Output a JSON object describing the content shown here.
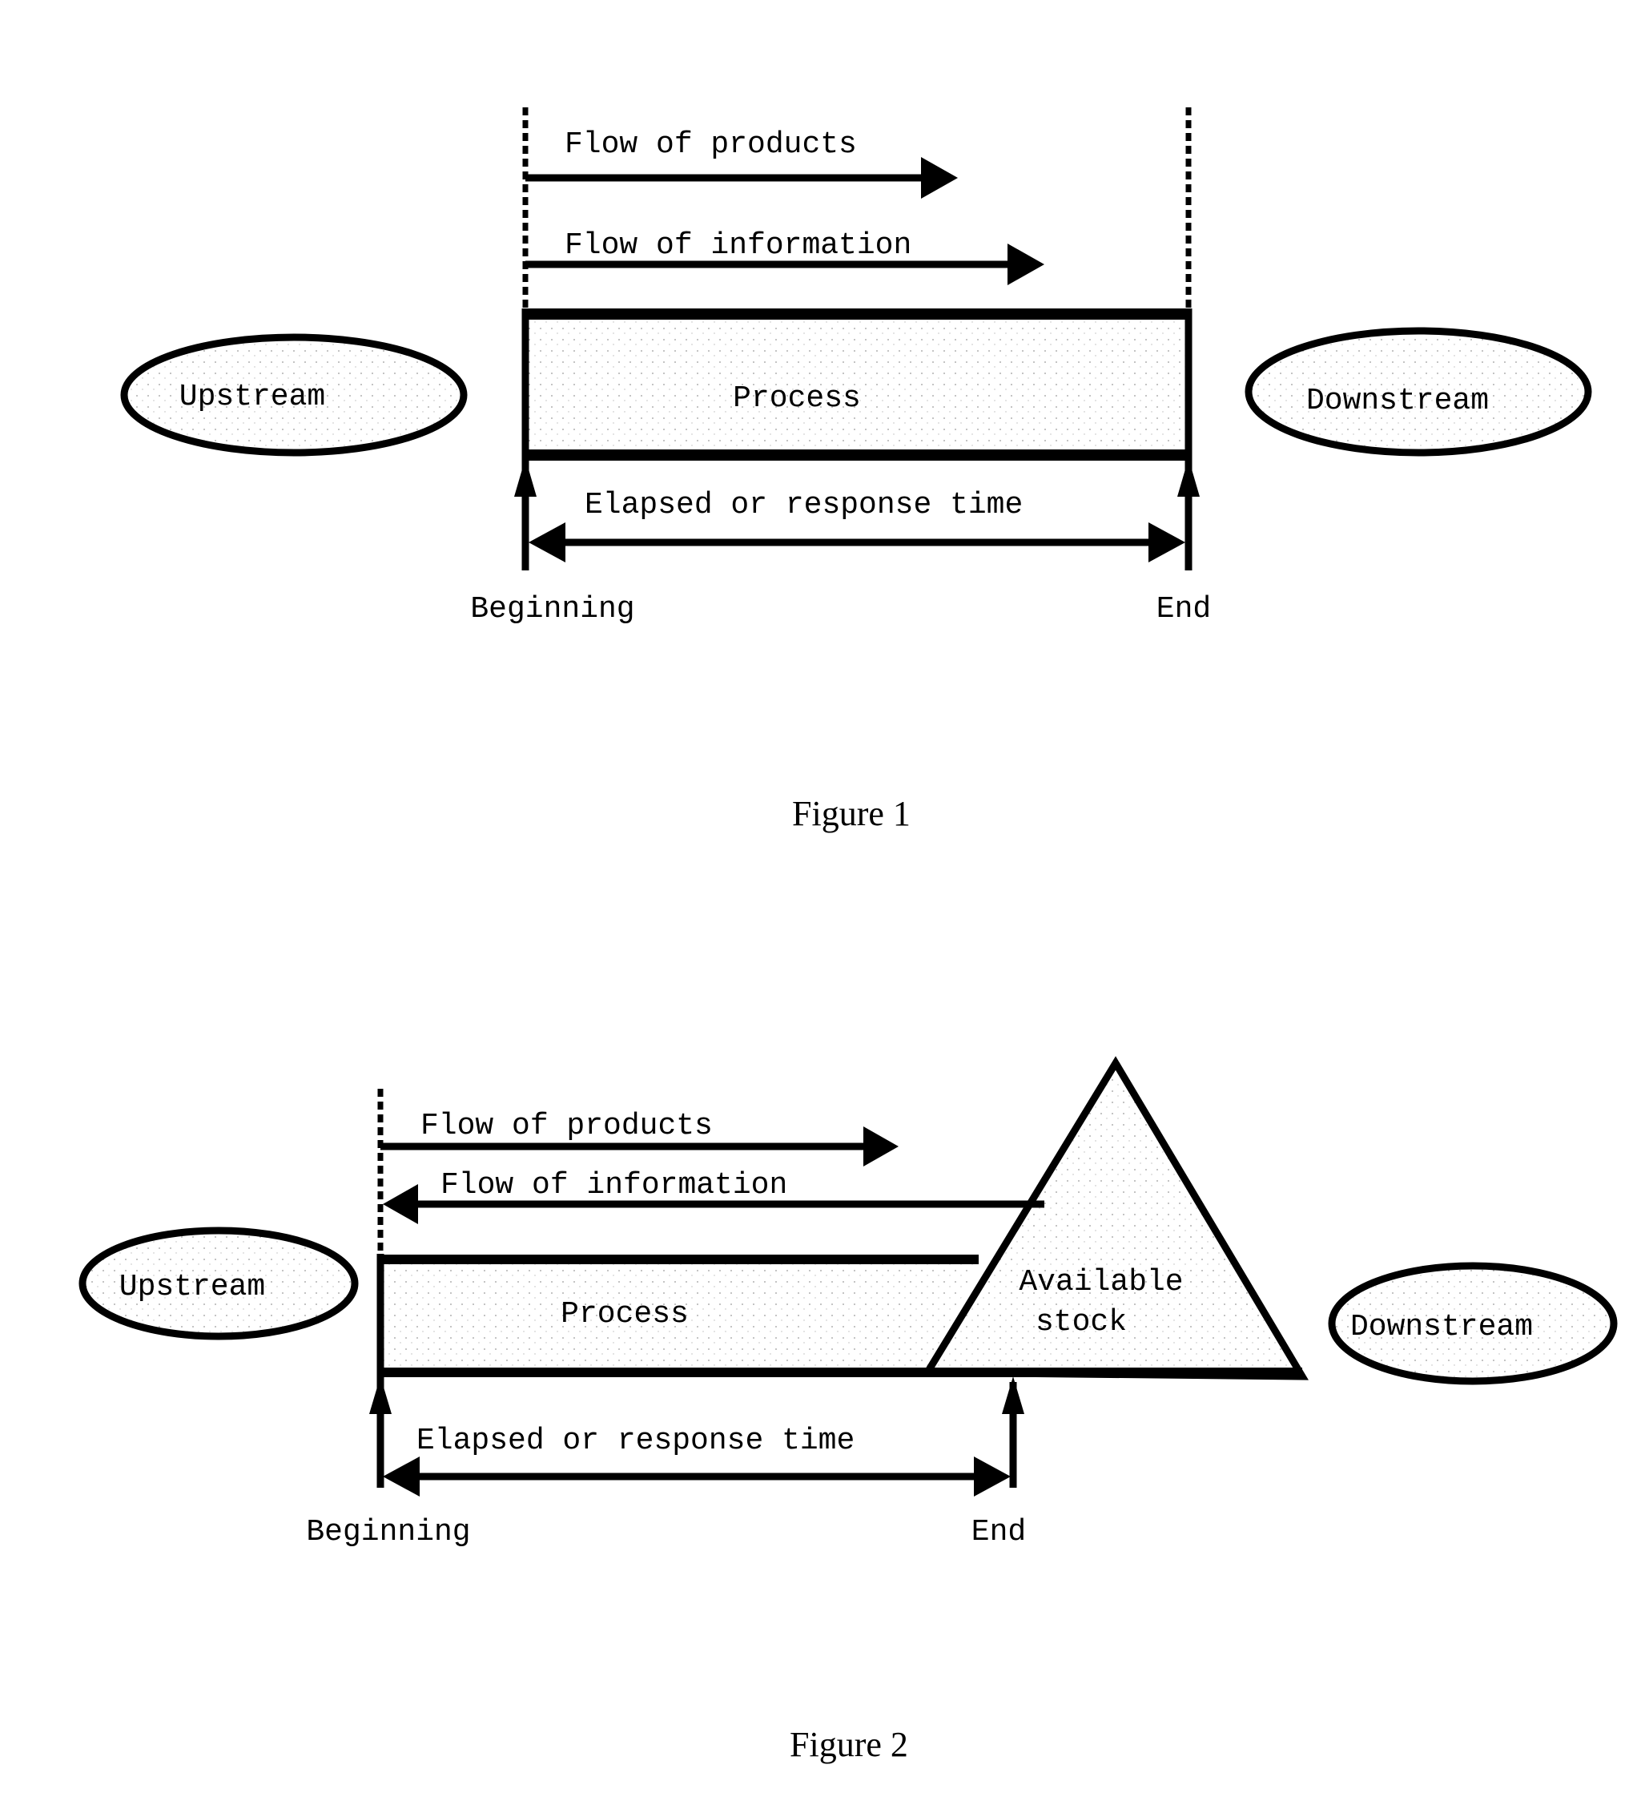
{
  "figure1": {
    "caption": "Figure 1",
    "upstream_label": "Upstream",
    "downstream_label": "Downstream",
    "process_label": "Process",
    "flow_products_label": "Flow of products",
    "flow_information_label": "Flow of information",
    "elapsed_label": "Elapsed or response time",
    "beginning_label": "Beginning",
    "end_label": "End"
  },
  "figure2": {
    "caption": "Figure 2",
    "upstream_label": "Upstream",
    "downstream_label": "Downstream",
    "process_label": "Process",
    "stock_label_line1": "Available",
    "stock_label_line2": "stock",
    "flow_products_label": "Flow of products",
    "flow_information_label": "Flow of information",
    "elapsed_label": "Elapsed or response time",
    "beginning_label": "Beginning",
    "end_label": "End"
  },
  "colors": {
    "ink": "#000000",
    "fill": "#f4f4f4",
    "background": "#ffffff"
  }
}
